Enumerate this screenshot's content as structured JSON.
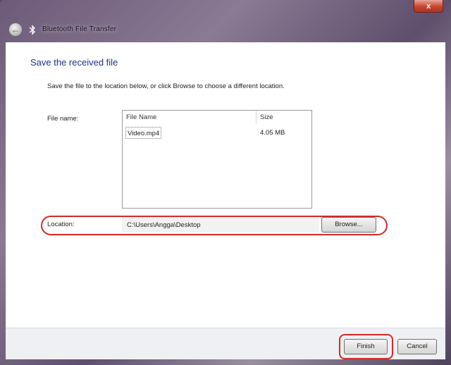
{
  "window": {
    "title": "Bluetooth File Transfer",
    "close_label": "x"
  },
  "icons": {
    "back": "back-arrow-icon",
    "bluetooth": "bluetooth-icon"
  },
  "page": {
    "heading": "Save the received file",
    "instruction": "Save the file to the location below, or click Browse to choose a different location."
  },
  "file_list": {
    "label": "File name:",
    "columns": [
      "File Name",
      "Size"
    ],
    "rows": [
      {
        "name": "Video.mp4",
        "size": "4.05 MB"
      }
    ]
  },
  "location": {
    "label": "Location:",
    "value": "C:\\Users\\Angga\\Desktop",
    "browse_label": "Browse..."
  },
  "footer": {
    "finish_label": "Finish",
    "cancel_label": "Cancel"
  },
  "colors": {
    "heading": "#1e3287",
    "highlight": "#d42a2a"
  }
}
